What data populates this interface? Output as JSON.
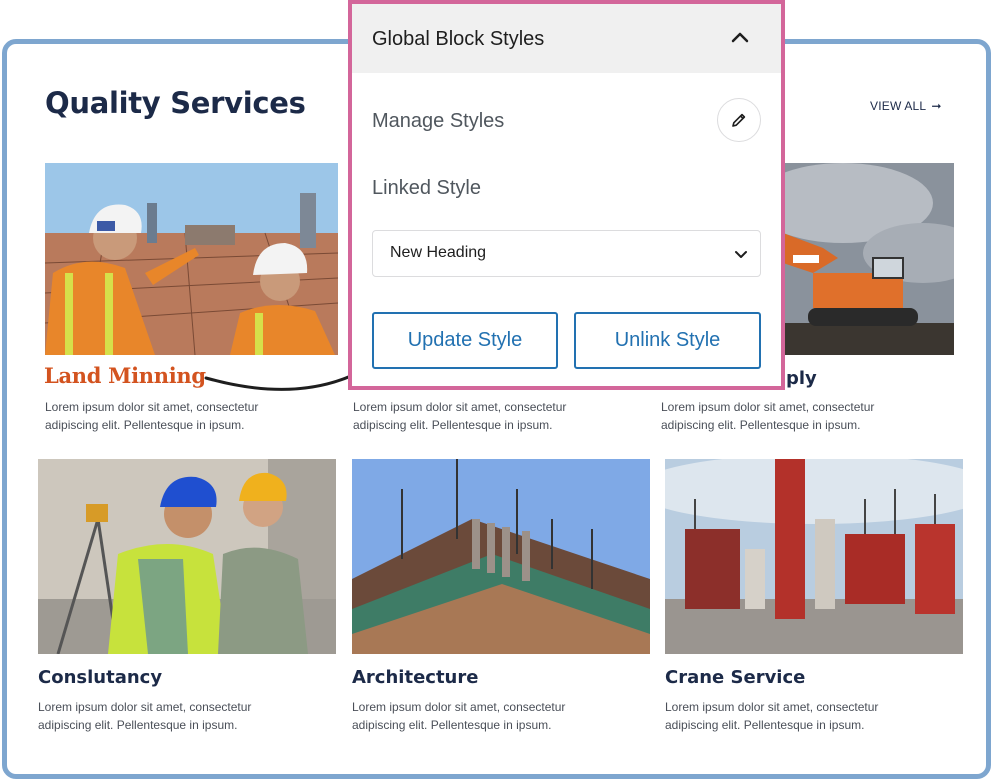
{
  "section": {
    "title": "Quality Services",
    "view_all": "VIEW ALL"
  },
  "cards": [
    {
      "title": "Land Minning",
      "text": "Lorem ipsum dolor sit amet, consectetur adipiscing elit. Pellentesque in ipsum.",
      "image": "construction-workers-site"
    },
    {
      "title": "",
      "text": "Lorem ipsum dolor sit amet, consectetur adipiscing elit. Pellentesque in ipsum.",
      "image": "hidden"
    },
    {
      "title": "ply",
      "text": "Lorem ipsum dolor sit amet, consectetur adipiscing elit. Pellentesque in ipsum.",
      "image": "excavator"
    },
    {
      "title": "Conslutancy",
      "text": "Lorem ipsum dolor sit amet, consectetur adipiscing elit. Pellentesque in ipsum.",
      "image": "workers-sitting"
    },
    {
      "title": "Architecture",
      "text": "Lorem ipsum dolor sit amet, consectetur adipiscing elit. Pellentesque in ipsum.",
      "image": "building-frame"
    },
    {
      "title": "Crane Service",
      "text": "Lorem ipsum dolor sit amet, consectetur adipiscing elit. Pellentesque in ipsum.",
      "image": "formwork"
    }
  ],
  "panel": {
    "title": "Global Block Styles",
    "manage_label": "Manage Styles",
    "linked_label": "Linked Style",
    "selected_style": "New Heading",
    "update_button": "Update Style",
    "unlink_button": "Unlink Style",
    "icons": {
      "collapse": "chevron-up-icon",
      "edit": "pencil-icon",
      "dropdown": "chevron-down-icon"
    }
  },
  "colors": {
    "accent": "#d3531f",
    "heading": "#1c2a48",
    "panel_border": "#d3669a",
    "frame": "#7ea6cf",
    "button": "#2271b1"
  }
}
